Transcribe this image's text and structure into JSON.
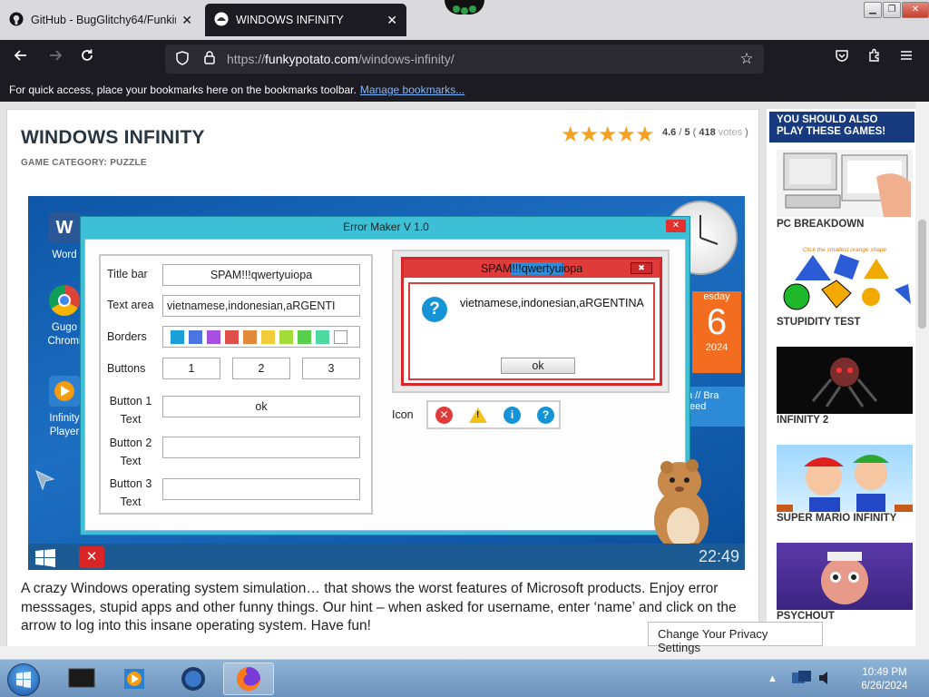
{
  "tabs": [
    {
      "title": "GitHub - BugGlitchy64/Funkin",
      "active": false
    },
    {
      "title": "WINDOWS INFINITY",
      "active": true
    }
  ],
  "browser": {
    "url_prefix": "https://",
    "url_domain": "funkypotato.com",
    "url_path": "/windows-infinity/",
    "bookmarks_message": "For quick access, place your bookmarks here on the bookmarks toolbar.",
    "bookmarks_link": "Manage bookmarks..."
  },
  "page": {
    "title": "WINDOWS INFINITY",
    "category": "GAME CATEGORY: PUZZLE",
    "rating": {
      "score": "4.6",
      "max": "5",
      "votes_count": "418",
      "votes_label": "votes",
      "stars": "★★★★★"
    },
    "description": "A crazy Windows operating system simulation… that shows the worst features of Microsoft products. Enjoy error messsages, stupid apps and other funny things. Our hint – when asked for username, enter ‘name’ and click on the arrow to log into this insane operating system. Have fun!"
  },
  "game": {
    "desktop_icons": [
      {
        "label": "Word",
        "icon": "word-icon",
        "color": "#2b5797"
      },
      {
        "label": "Gugo Chromi",
        "icon": "chrome-icon",
        "color": "#db4437"
      },
      {
        "label": "Infinity Player",
        "icon": "player-icon",
        "color": "#f39c12"
      }
    ],
    "calendar_weekday": "esday",
    "calendar_day": "6",
    "calendar_year": "2024",
    "rss_line1": "h // Bra",
    "rss_line2": "feed",
    "time": "22:49",
    "maker": {
      "title": "Error Maker V 1.0",
      "labels": {
        "title_bar": "Title bar",
        "text_area": "Text area",
        "borders": "Borders",
        "buttons": "Buttons",
        "button1_text": "Button 1 Text",
        "button2_text": "Button 2 Text",
        "button3_text": "Button 3 Text",
        "icon": "Icon"
      },
      "values": {
        "title_bar": "SPAM!!!qwertyuiopa",
        "text_area": "vietnamese,indonesian,aRGENTI",
        "button_count_1": "1",
        "button_count_2": "2",
        "button_count_3": "3",
        "button1_text": "ok",
        "button2_text": "",
        "button3_text": ""
      },
      "border_colors": [
        "#1a9fd6",
        "#4b75e0",
        "#a64fe0",
        "#e0504b",
        "#e28a3b",
        "#f2cc3a",
        "#a2dd3a",
        "#58d04b",
        "#4fd9a1",
        "#ffffff"
      ],
      "preview": {
        "title_pre": "SPAM",
        "title_hl": "!!!qwertyui",
        "title_post": "opa",
        "message": "vietnamese,indonesian,aRGENTINA",
        "ok_label": "ok"
      }
    }
  },
  "sidebar": {
    "heading": "YOU SHOULD ALSO PLAY THESE GAMES!",
    "games": [
      {
        "label": "PC BREAKDOWN",
        "thumb": "pc-breakdown-thumbnail"
      },
      {
        "label": "STUPIDITY TEST",
        "thumb": "stupidity-test-thumbnail",
        "caption": "Click the smallest orange shape"
      },
      {
        "label": "INFINITY 2",
        "thumb": "infinity-2-thumbnail"
      },
      {
        "label": "SUPER MARIO INFINITY",
        "thumb": "super-mario-infinity-thumbnail"
      },
      {
        "label": "PSYCHOUT",
        "thumb": "psychout-thumbnail"
      }
    ]
  },
  "privacy_button": "Change Your Privacy Settings",
  "taskbar": {
    "time": "10:49 PM",
    "date": "6/26/2024"
  }
}
